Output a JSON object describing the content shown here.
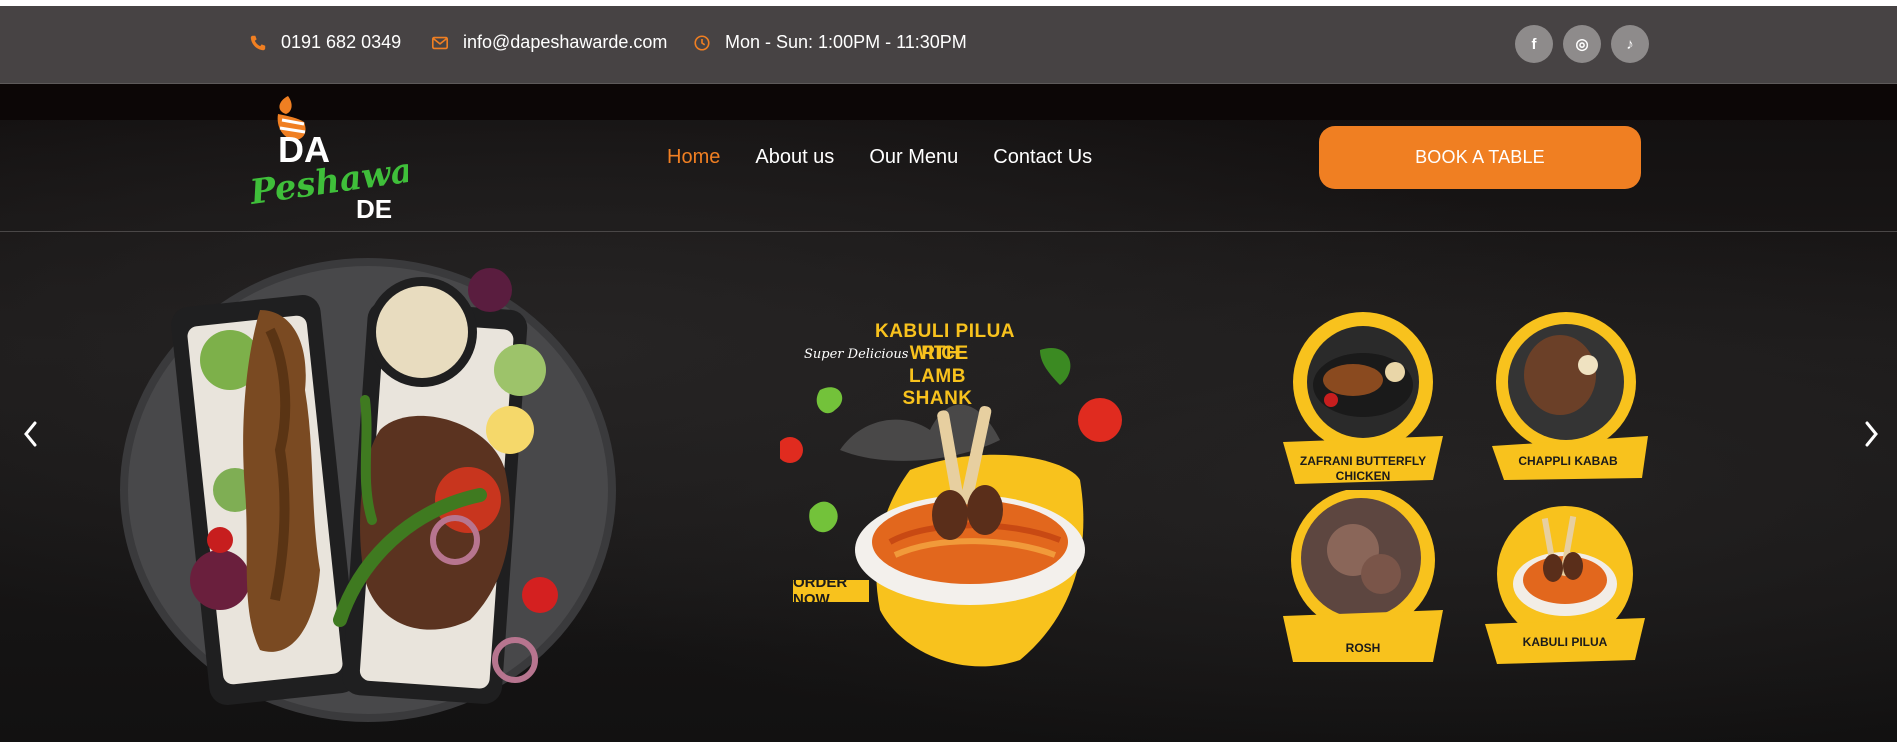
{
  "topbar": {
    "phone": "0191 682 0349",
    "email": "info@dapeshawarde.com",
    "hours": "Mon - Sun: 1:00PM - 11:30PM",
    "social": [
      {
        "name": "facebook-icon",
        "glyph": "f"
      },
      {
        "name": "instagram-icon",
        "glyph": "◎"
      },
      {
        "name": "tiktok-icon",
        "glyph": "♪"
      }
    ]
  },
  "logo": {
    "line1": "DA",
    "line2": "Peshawar",
    "line3": "DE"
  },
  "nav": {
    "items": [
      "Home",
      "About us",
      "Our Menu",
      "Contact Us"
    ],
    "active": "Home"
  },
  "cta": {
    "book_label": "BOOK A TABLE"
  },
  "promo": {
    "line1": "KABULI PILUA RICE",
    "script": "Super Delicious",
    "line2": "WITH",
    "line3": "LAMB SHANK",
    "order": "ORDER NOW"
  },
  "dishes": [
    {
      "label_1": "ZAFRANI BUTTERFLY",
      "label_2": "CHICKEN"
    },
    {
      "label_1": "CHAPPLI KABAB",
      "label_2": ""
    },
    {
      "label_1": "ROSH",
      "label_2": ""
    },
    {
      "label_1": "KABULI PILUA",
      "label_2": ""
    }
  ],
  "colors": {
    "accent": "#f07f22",
    "topbar_bg": "#474344",
    "promo_yellow": "#f8c21d",
    "logo_green": "#3fbf3a"
  }
}
